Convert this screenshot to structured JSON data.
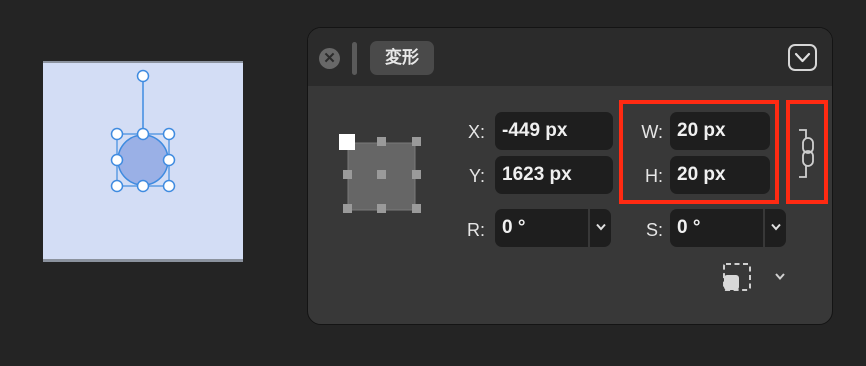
{
  "canvas": {
    "background": "#d3ddf5",
    "shape_fill": "#9ab0e6",
    "handle_color": "#3f8be0"
  },
  "panel": {
    "close_icon": "close-icon",
    "title": "変形",
    "collapse_icon": "chevron-down-icon",
    "anchor_icon": "anchor-grid-icon",
    "x_label": "X:",
    "x_value": "-449 px",
    "y_label": "Y:",
    "y_value": "1623 px",
    "w_label": "W:",
    "w_value": "20 px",
    "h_label": "H:",
    "h_value": "20 px",
    "r_label": "R:",
    "r_value": "0 °",
    "s_label": "S:",
    "s_value": "0 °",
    "lock_icon": "chain-link-icon",
    "bbox_icon": "bounding-box-icon",
    "highlight_color": "#ff2a12"
  }
}
